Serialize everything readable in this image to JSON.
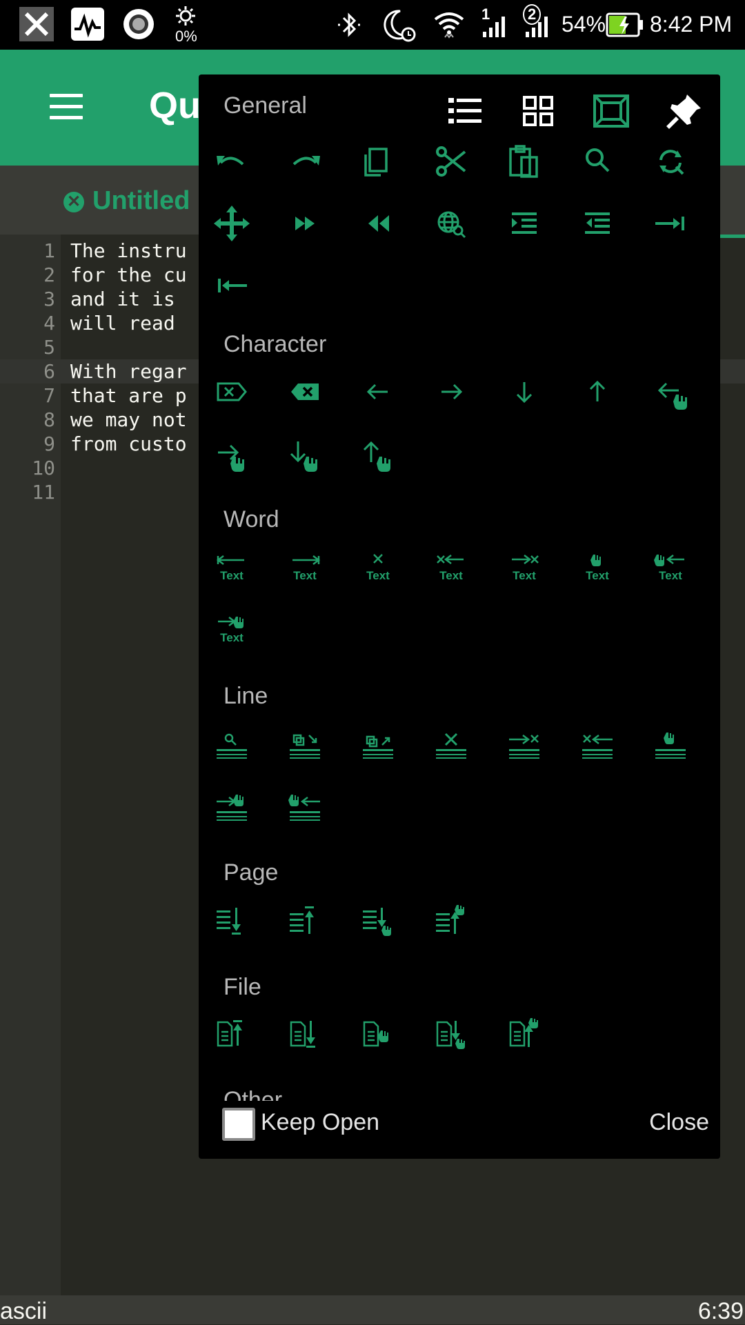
{
  "status_bar": {
    "brightness": "0%",
    "sim1": "1",
    "sim2": "2",
    "battery": "54%",
    "time": "8:42 PM"
  },
  "app_bar": {
    "title": "Qui"
  },
  "tab": {
    "label": "Untitled",
    "close_icon": "close-circle-icon"
  },
  "editor": {
    "lines": [
      {
        "num": "1",
        "text": "The instru"
      },
      {
        "num": "2",
        "text": "for the cu"
      },
      {
        "num": "3",
        "text": "and it is "
      },
      {
        "num": "4",
        "text": "will read "
      },
      {
        "num": "5",
        "text": ""
      },
      {
        "num": "6",
        "text": "With regar"
      },
      {
        "num": "7",
        "text": "that are p"
      },
      {
        "num": "8",
        "text": "we may not"
      },
      {
        "num": "9",
        "text": "from custo"
      },
      {
        "num": "10",
        "text": ""
      },
      {
        "num": "11",
        "text": ""
      }
    ]
  },
  "bottom_status": {
    "encoding": "ascii",
    "position": "6:39"
  },
  "dialog": {
    "sections": {
      "general": "General",
      "character": "Character",
      "word": "Word",
      "line": "Line",
      "page": "Page",
      "file": "File",
      "other": "Other"
    },
    "word_icon_text": "Text",
    "header_icons": [
      "list-view-icon",
      "grid-view-icon",
      "fit-screen-icon",
      "pin-icon"
    ],
    "keep_open_label": "Keep Open",
    "close_label": "Close",
    "accent_color": "#22a06b"
  }
}
